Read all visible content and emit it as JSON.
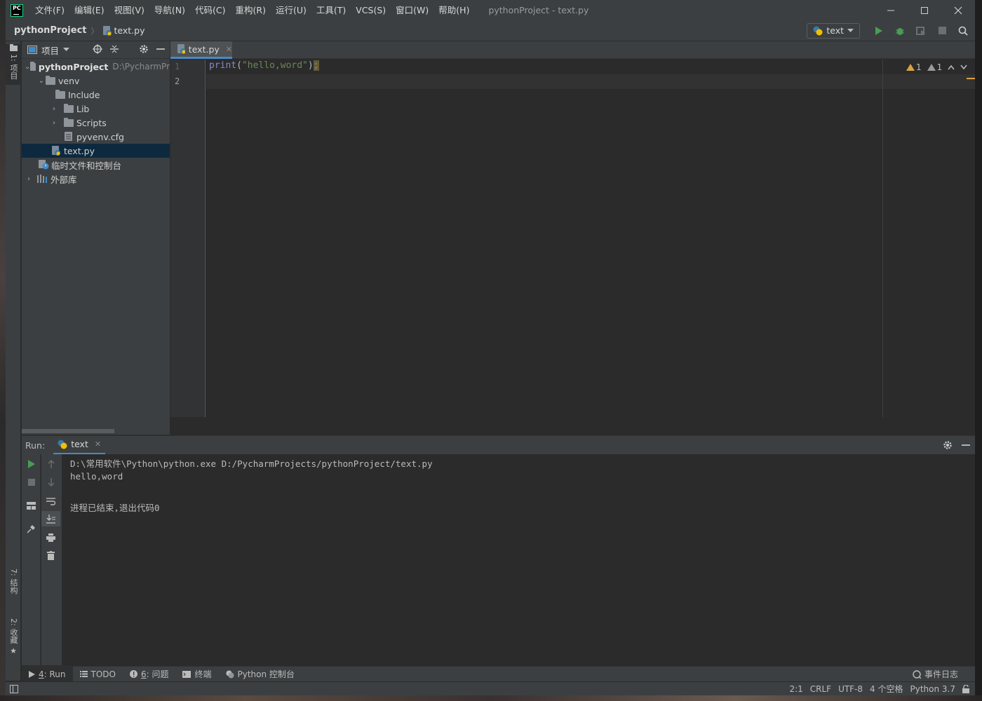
{
  "titlebar": {
    "logo_text": "PC",
    "menu": [
      "文件(F)",
      "编辑(E)",
      "视图(V)",
      "导航(N)",
      "代码(C)",
      "重构(R)",
      "运行(U)",
      "工具(T)",
      "VCS(S)",
      "窗口(W)",
      "帮助(H)"
    ],
    "window_title": "pythonProject - text.py"
  },
  "navbar": {
    "project": "pythonProject",
    "file": "text.py",
    "run_config": "text"
  },
  "left_strip": {
    "project_tab": "1: 项目",
    "structure_tab": "7: 结构",
    "favorites_tab": "2: 收藏"
  },
  "project_panel": {
    "title": "项目",
    "tree": {
      "root": "pythonProject",
      "root_path": "D:\\PycharmPr",
      "venv": "venv",
      "include": "Include",
      "lib": "Lib",
      "scripts": "Scripts",
      "cfg": "pyvenv.cfg",
      "file": "text.py",
      "scratches": "临时文件和控制台",
      "external": "外部库"
    }
  },
  "editor": {
    "tab_label": "text.py",
    "line_numbers": [
      "1",
      "2"
    ],
    "code": {
      "fn": "print",
      "open": "(",
      "string": "\"hello,word\"",
      "close": ")",
      "semi": ";"
    },
    "warnings_count": "1",
    "weak_warnings_count": "1"
  },
  "run_panel": {
    "label": "Run:",
    "tab": "text",
    "console": [
      "D:\\常用软件\\Python\\python.exe D:/PycharmProjects/pythonProject/text.py",
      "hello,word",
      "",
      "进程已结束,退出代码0"
    ]
  },
  "bottom_tabs": {
    "run_num": "4",
    "run": ": Run",
    "todo": "TODO",
    "problems_num": "6",
    "problems": ": 问题",
    "terminal": "终端",
    "python_console": "Python 控制台",
    "event_log": "事件日志"
  },
  "statusbar": {
    "position": "2:1",
    "line_sep": "CRLF",
    "encoding": "UTF-8",
    "indent": "4 个空格",
    "interpreter": "Python 3.7"
  },
  "colors": {
    "accent": "#4a88c7",
    "run_green": "#499c54",
    "warning": "#d9a343"
  }
}
